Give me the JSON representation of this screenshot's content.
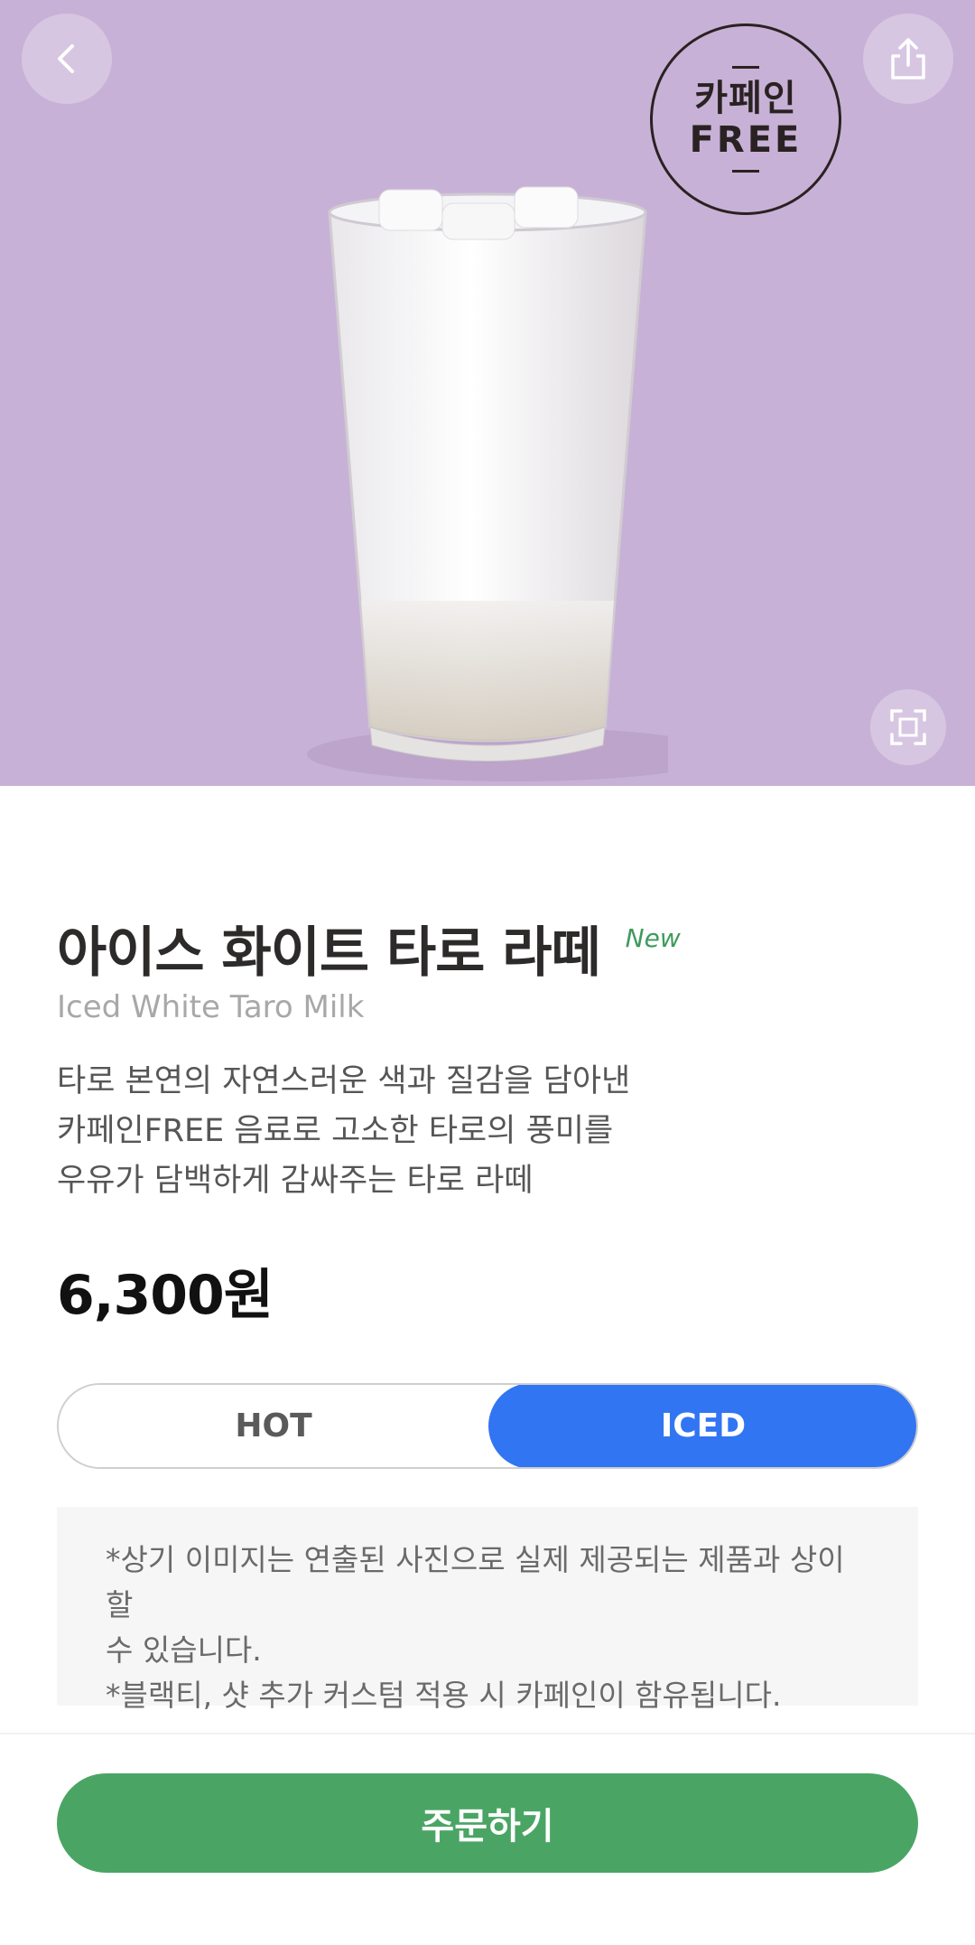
{
  "hero": {
    "background_color": "#c8b1d6",
    "badge": {
      "line1": "카페인",
      "line2": "FREE"
    },
    "icons": {
      "back": "chevron-left-icon",
      "share": "share-icon",
      "zoom": "expand-icon"
    }
  },
  "product": {
    "name_ko": "아이스 화이트 타로 라떼",
    "new_tag": "New",
    "name_en": "Iced White Taro Milk",
    "description_lines": [
      "타로 본연의 자연스러운 색과 질감을 담아낸",
      "카페인FREE 음료로 고소한 타로의 풍미를",
      "우유가 담백하게 감싸주는 타로 라떼"
    ],
    "price": "6,300원"
  },
  "temperature": {
    "options": [
      "HOT",
      "ICED"
    ],
    "selected": "ICED",
    "accent_color": "#3275f2"
  },
  "notice": {
    "lines": [
      "*상기 이미지는 연출된 사진으로 실제 제공되는 제품과 상이할",
      "수 있습니다.",
      "*블랙티, 샷 추가 커스텀 적용 시 카페인이 함유됩니다."
    ]
  },
  "order": {
    "label": "주문하기",
    "color": "#4aa564"
  }
}
